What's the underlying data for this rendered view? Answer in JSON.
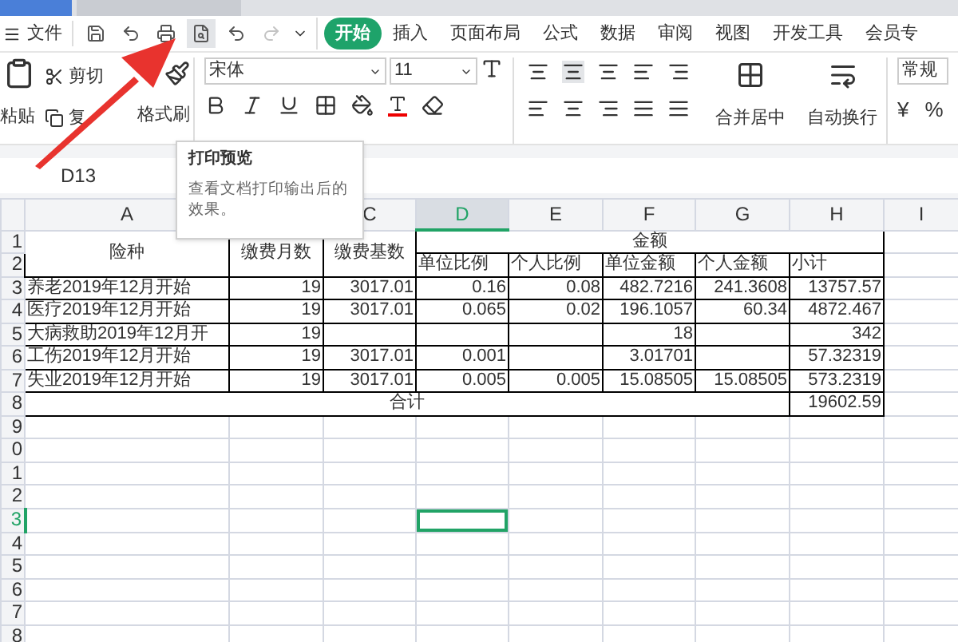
{
  "menu": {
    "file": "文件",
    "quick_access": [
      {
        "hovered": false,
        "disabled": false
      },
      {
        "hovered": false,
        "disabled": false
      },
      {
        "hovered": false,
        "disabled": false
      },
      {
        "hovered": true,
        "disabled": false
      },
      {
        "hovered": false,
        "disabled": false
      },
      {
        "hovered": false,
        "disabled": true
      }
    ],
    "tabs": [
      {
        "label": "开始",
        "selected": true
      },
      {
        "label": "插入",
        "selected": false
      },
      {
        "label": "页面布局",
        "selected": false
      },
      {
        "label": "公式",
        "selected": false
      },
      {
        "label": "数据",
        "selected": false
      },
      {
        "label": "审阅",
        "selected": false
      },
      {
        "label": "视图",
        "selected": false
      },
      {
        "label": "开发工具",
        "selected": false
      },
      {
        "label": "会员专",
        "selected": false
      }
    ]
  },
  "ribbon": {
    "paste": "粘贴",
    "cut": "剪切",
    "copy": "复",
    "format_painter": "格式刷",
    "font": "宋体",
    "font_size": "11",
    "merge": "合并居中",
    "wrap": "自动换行",
    "number_format": "常规",
    "currency": "¥",
    "percent": "%"
  },
  "tooltip": {
    "title": "打印预览",
    "text": "查看文档打印输出后的效果。"
  },
  "name_box": "D13",
  "columns": [
    {
      "label": "A",
      "selected": false
    },
    {
      "label": "C",
      "selected": false
    },
    {
      "label": "D",
      "selected": true
    },
    {
      "label": "E",
      "selected": false
    },
    {
      "label": "F",
      "selected": false
    },
    {
      "label": "G",
      "selected": false
    },
    {
      "label": "H",
      "selected": false
    },
    {
      "label": "I",
      "selected": false
    }
  ],
  "row_headers": [
    {
      "label": "1",
      "selected": false
    },
    {
      "label": "2",
      "selected": false
    },
    {
      "label": "3",
      "selected": false
    },
    {
      "label": "4",
      "selected": false
    },
    {
      "label": "5",
      "selected": false
    },
    {
      "label": "6",
      "selected": false
    },
    {
      "label": "7",
      "selected": false
    },
    {
      "label": "8",
      "selected": false
    },
    {
      "label": "9",
      "selected": false
    },
    {
      "label": "0",
      "selected": false
    },
    {
      "label": "1",
      "selected": false
    },
    {
      "label": "2",
      "selected": false
    },
    {
      "label": "3",
      "selected": true
    },
    {
      "label": "4",
      "selected": false
    },
    {
      "label": "5",
      "selected": false
    },
    {
      "label": "6",
      "selected": false
    },
    {
      "label": "7",
      "selected": false
    },
    {
      "label": "8",
      "selected": false
    }
  ],
  "header": {
    "type": "险种",
    "months": "缴费月数",
    "base": "缴费基数",
    "amount": "金额",
    "sub": [
      "单位比例",
      "个人比例",
      "单位金额",
      "个人金额",
      "小计"
    ]
  },
  "rows": [
    {
      "cells": [
        "养老2019年12月开始",
        "19",
        "3017.01",
        "0.16",
        "0.08",
        "482.7216",
        "241.3608",
        "13757.57"
      ]
    },
    {
      "cells": [
        "医疗2019年12月开始",
        "19",
        "3017.01",
        "0.065",
        "0.02",
        "196.1057",
        "60.34",
        "4872.467"
      ]
    },
    {
      "cells": [
        "大病救助2019年12月开",
        "19",
        null,
        null,
        null,
        "18",
        null,
        "342"
      ]
    },
    {
      "cells": [
        "工伤2019年12月开始",
        "19",
        "3017.01",
        "0.001",
        null,
        "3.01701",
        null,
        "57.32319"
      ]
    },
    {
      "cells": [
        "失业2019年12月开始",
        "19",
        "3017.01",
        "0.005",
        "0.005",
        "15.08505",
        "15.08505",
        "573.2319"
      ]
    }
  ],
  "total": {
    "label": "合计",
    "value": "19602.59"
  }
}
